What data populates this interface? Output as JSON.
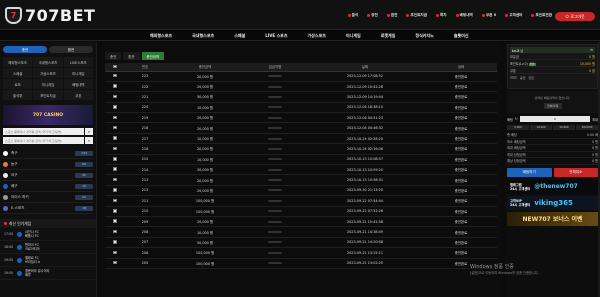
{
  "logo": {
    "text": "707BET",
    "mark": "7"
  },
  "topmenu": [
    "출석",
    "충전",
    "환전",
    "포인트지급",
    "쪽지",
    "베팅내역",
    "쿠폰 0",
    "고객센터",
    "포인트전환"
  ],
  "login_button": "로그아웃",
  "nav": [
    "해외형스포츠",
    "국내형스포츠",
    "스페셜",
    "LIVE 스포츠",
    "가상스포츠",
    "미니게임",
    "로켓게임",
    "정식카지노",
    "슬롯머신"
  ],
  "left": {
    "tabs": [
      "충전",
      "환전"
    ],
    "grid": [
      "해외형스포츠",
      "국내형스포츠",
      "LIVE스포츠",
      "스페셜",
      "가상스포츠",
      "미니게임",
      "로또",
      "미니게임",
      "베팅내역",
      "출석부",
      "포인트지급",
      "쿠폰"
    ],
    "promo": "707 CASINO",
    "search_placeholder": "스포츠 종목이나 경기를 검색 (국가/리그/팀명)",
    "search_placeholder2": "스포츠 종목이나 경기를 검색 (국가/리그/팀명)",
    "sports": [
      {
        "name": "축구",
        "count": "234",
        "color": "#fff"
      },
      {
        "name": "농구",
        "count": "56",
        "color": "#e67e22"
      },
      {
        "name": "야구",
        "count": "32",
        "color": "#eee"
      },
      {
        "name": "배구",
        "count": "12",
        "color": "#1565c0"
      },
      {
        "name": "아이스 하키",
        "count": "22",
        "color": "#999"
      },
      {
        "name": "E-스포츠",
        "count": "18",
        "color": "#5c6bc0"
      }
    ],
    "live_title": "최신 인기게임",
    "matches": [
      {
        "time": "17:00",
        "teams": "샤인나 FC\n빠툼나 FC"
      },
      {
        "time": "18:00",
        "teams": "덴마크 FC\n크로아티아"
      },
      {
        "time": "19:00",
        "teams": "벨레르 FC\n브라질리 A"
      },
      {
        "time": "19:00",
        "teams": "콜롬비아 유나이티\n페루"
      }
    ]
  },
  "main": {
    "subtabs": [
      "충전",
      "환전",
      "충전내역"
    ],
    "columns": [
      "",
      "번호",
      "충전금액",
      "입금자명",
      "날짜",
      "상태"
    ],
    "rows": [
      {
        "no": "223",
        "amount": "20,000 원",
        "date": "2023-12-09 17:08:52",
        "status": "충전완료"
      },
      {
        "no": "222",
        "amount": "20,000 원",
        "date": "2023-12-09 10:42:28",
        "status": "충전완료"
      },
      {
        "no": "221",
        "amount": "30,000 원",
        "date": "2023-12-09 14:19:44",
        "status": "충전완료"
      },
      {
        "no": "220",
        "amount": "10,000 원",
        "date": "2023-12-04 18:38:10",
        "status": "충전완료"
      },
      {
        "no": "219",
        "amount": "20,000 원",
        "date": "2023-12-04 04:51:23",
        "status": "충전완료"
      },
      {
        "no": "218",
        "amount": "20,000 원",
        "date": "2023-12-04 04:46:32",
        "status": "충전완료"
      },
      {
        "no": "217",
        "amount": "10,000 원",
        "date": "2023-10-24 02:28:20",
        "status": "충전완료"
      },
      {
        "no": "216",
        "amount": "20,000 원",
        "date": "2023-10-24 02:16:06",
        "status": "충전완료"
      },
      {
        "no": "215",
        "amount": "10,000 원",
        "date": "2023-10-13 10:08:57",
        "status": "충전완료"
      },
      {
        "no": "214",
        "amount": "30,000 원",
        "date": "2023-10-13 10:59:20",
        "status": "충전완료"
      },
      {
        "no": "213",
        "amount": "20,000 원",
        "date": "2023-10-13 10:58:31",
        "status": "충전완료"
      },
      {
        "no": "212",
        "amount": "20,000 원",
        "date": "2023-09-30 21:13:20",
        "status": "충전완료"
      },
      {
        "no": "211",
        "amount": "100,000 원",
        "date": "2023-09-22 07:54:44",
        "status": "충전완료"
      },
      {
        "no": "210",
        "amount": "100,000 원",
        "date": "2023-09-22 07:52:26",
        "status": "충전완료"
      },
      {
        "no": "209",
        "amount": "20,000 원",
        "date": "2023-09-21 15:41:58",
        "status": "충전완료"
      },
      {
        "no": "208",
        "amount": "10,000 원",
        "date": "2023-09-21 14:38:49",
        "status": "충전완료"
      },
      {
        "no": "207",
        "amount": "50,000 원",
        "date": "2023-09-21 14:20:48",
        "status": "충전완료"
      },
      {
        "no": "206",
        "amount": "100,000 원",
        "date": "2023-09-21 13:25:11",
        "status": "충전완료"
      },
      {
        "no": "205",
        "amount": "100,000 원",
        "date": "2023-09-21 13:02:20",
        "status": "충전완료"
      }
    ]
  },
  "right": {
    "user_level": "Lv.3",
    "user_name": "님",
    "rows": [
      {
        "label": "보유금",
        "value": "0 원"
      },
      {
        "label": "포인트(Lv.0)",
        "badge": "전환",
        "value": "10,000 원"
      },
      {
        "label": "쿠폰",
        "value": "0 장"
      }
    ],
    "toggles": [
      "충전",
      "환전"
    ],
    "notice": "선택된 배팅내역이 없습니다.",
    "notice_btn": "전체삭제",
    "bet_label": "배팅",
    "bet_value": "0",
    "bet_max": "최대",
    "quick": [
      "5,000",
      "10,000",
      "50,000",
      "100,000"
    ],
    "info": [
      {
        "label": "총 배당",
        "value": "0.00 배"
      },
      {
        "label": "최소 배팅금액",
        "value": "0 원"
      },
      {
        "label": "최대 배팅금액",
        "value": "0 원"
      },
      {
        "label": "최대 당첨금액",
        "value": "0 원"
      },
      {
        "label": "예상 당첨금액",
        "value": "0 원"
      }
    ],
    "btn_bet": "배팅하기",
    "btn_clear": "전체취소",
    "banner1_title": "텔레그램",
    "banner1_sub": "24시 고객센터",
    "banner1_id": "@thenew707",
    "banner2_title": "고객VIP",
    "banner2_sub": "24시 고객센터",
    "banner2_id": "viking365",
    "banner3": "NEW707 보너스 이벤"
  },
  "watermark": {
    "title": "Windows 정품 인증",
    "sub": "[설정]으로 이동하여 Windows를 정품 인증합니다."
  }
}
